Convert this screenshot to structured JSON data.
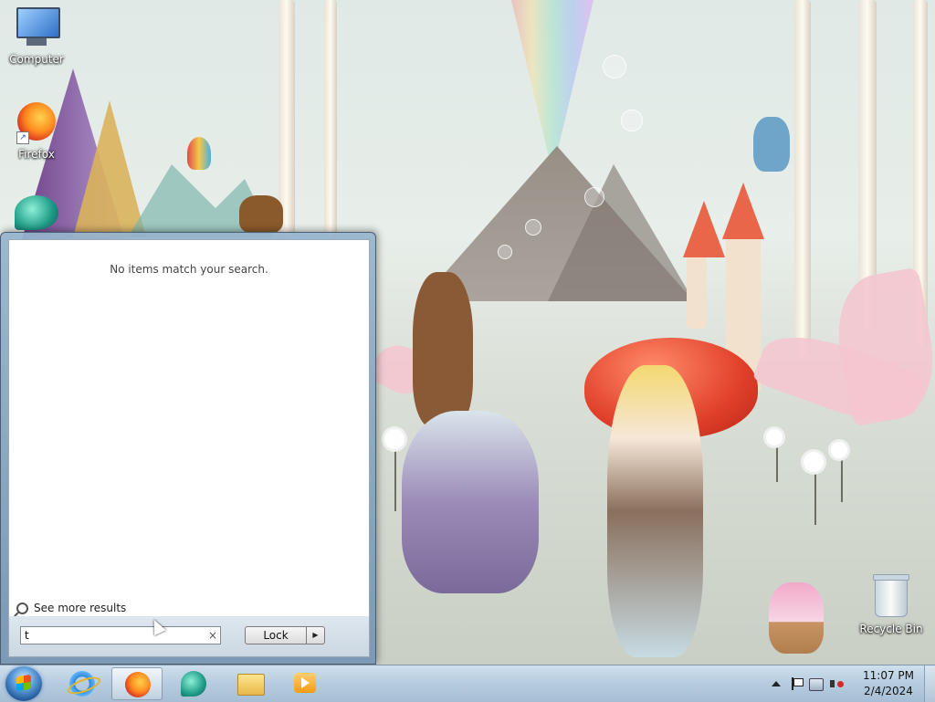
{
  "desktop": {
    "icons": [
      {
        "label": "Computer",
        "icon": "computer-icon"
      },
      {
        "label": "Firefox",
        "icon": "firefox-icon"
      },
      {
        "label": "",
        "icon": "teal-app-icon"
      },
      {
        "label": "Recycle Bin",
        "icon": "recycle-bin-icon"
      }
    ]
  },
  "start_menu": {
    "no_results_text": "No items match your search.",
    "see_more_label": "See more results",
    "search": {
      "value": "t",
      "clear_icon": "×"
    },
    "lock_label": "Lock",
    "lock_arrow": "▶"
  },
  "taskbar": {
    "pinned": [
      {
        "name": "internet-explorer",
        "icon": "ie-icon"
      },
      {
        "name": "firefox",
        "icon": "firefox-icon",
        "active": true
      },
      {
        "name": "teal-app",
        "icon": "teal-app-icon"
      },
      {
        "name": "windows-explorer",
        "icon": "folder-icon"
      },
      {
        "name": "media-player",
        "icon": "media-player-icon"
      }
    ],
    "clock": {
      "time": "11:07 PM",
      "date": "2/4/2024"
    }
  },
  "colors": {
    "taskbar": "#b8cde0",
    "start_menu_frame": "#8fb0cc",
    "wallpaper_apple": "#e1402a"
  }
}
